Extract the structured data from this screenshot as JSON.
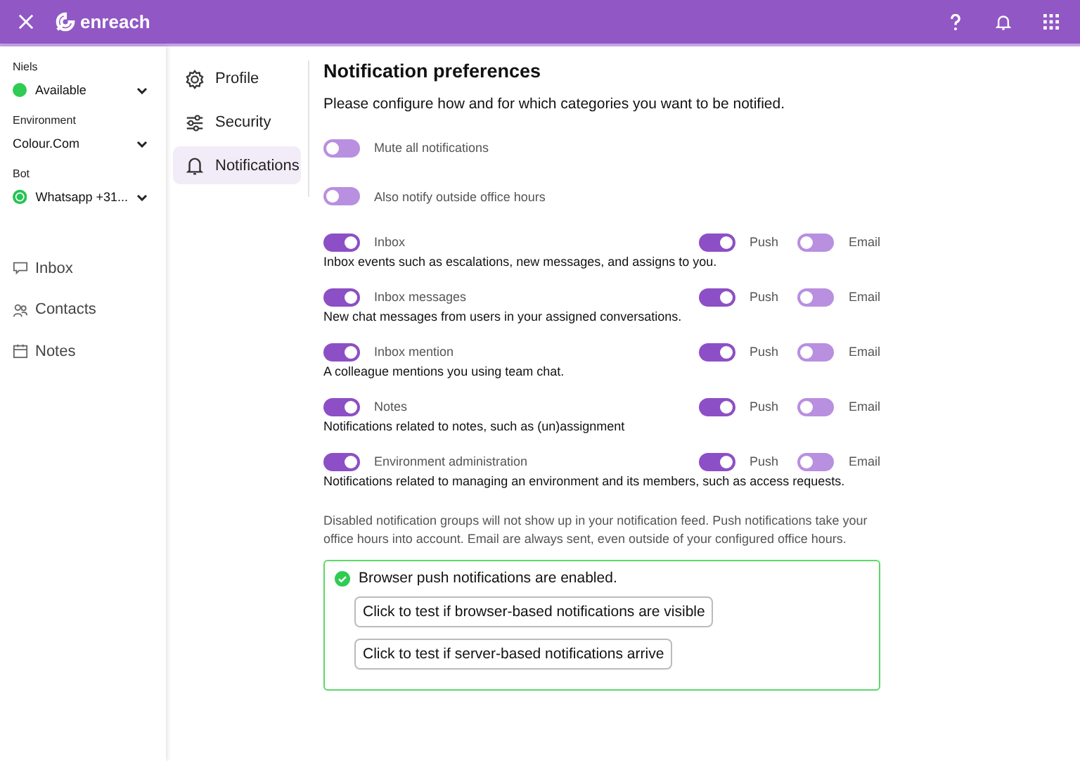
{
  "header": {
    "logo_text": "enreach"
  },
  "sidebar": {
    "user_label": "Niels",
    "status": "Available",
    "environment_label": "Environment",
    "environment_value": "Colour.Com",
    "bot_label": "Bot",
    "bot_value": "Whatsapp +31...",
    "nav": [
      {
        "label": "Inbox"
      },
      {
        "label": "Contacts"
      },
      {
        "label": "Notes"
      }
    ]
  },
  "settings_nav": [
    {
      "label": "Profile",
      "selected": false
    },
    {
      "label": "Security",
      "selected": false
    },
    {
      "label": "Notifications",
      "selected": true
    }
  ],
  "main": {
    "title": "Notification preferences",
    "intro": "Please configure how and for which categories you want to be notified.",
    "global_toggles": [
      {
        "label": "Mute all notifications",
        "on": false
      },
      {
        "label": "Also notify outside office hours",
        "on": false
      }
    ],
    "categories": [
      {
        "label": "Inbox",
        "on": true,
        "description": "Inbox events such as escalations, new messages, and assigns to you.",
        "push_label": "Push",
        "push_on": true,
        "email_label": "Email",
        "email_on": false
      },
      {
        "label": "Inbox messages",
        "on": true,
        "description": "New chat messages from users in your assigned conversations.",
        "push_label": "Push",
        "push_on": true,
        "email_label": "Email",
        "email_on": false
      },
      {
        "label": "Inbox mention",
        "on": true,
        "description": "A colleague mentions you using team chat.",
        "push_label": "Push",
        "push_on": true,
        "email_label": "Email",
        "email_on": false
      },
      {
        "label": "Notes",
        "on": true,
        "description": "Notifications related to notes, such as (un)assignment",
        "push_label": "Push",
        "push_on": true,
        "email_label": "Email",
        "email_on": false
      },
      {
        "label": "Environment administration",
        "on": true,
        "description": "Notifications related to managing an environment and its members, such as access requests.",
        "push_label": "Push",
        "push_on": true,
        "email_label": "Email",
        "email_on": false
      }
    ],
    "footnote": "Disabled notification groups will not show up in your notification feed. Push notifications take your office hours into account. Email are always sent, even outside of your configured office hours.",
    "status_box": {
      "message": "Browser push notifications are enabled.",
      "buttons": [
        "Click to test if browser-based notifications are visible",
        "Click to test if server-based notifications arrive"
      ]
    }
  }
}
